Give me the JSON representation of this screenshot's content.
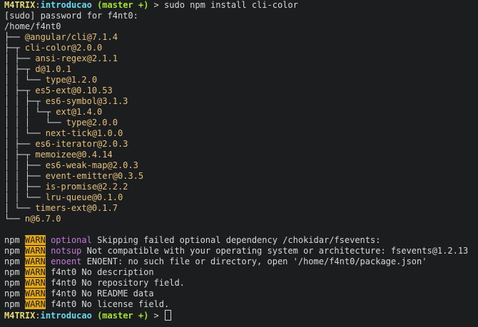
{
  "prompt1": {
    "user": "M4TRIX",
    "sep": ":",
    "dir": "introducao",
    "branch": "(master +)",
    "arrow": " > ",
    "command": "sudo npm install cli-color"
  },
  "sudo_line": "[sudo] password for f4nt0:",
  "root_path": "/home/f4nt0",
  "tree": [
    {
      "prefix": "├── ",
      "pkg": "@angular/cli@7.1.4"
    },
    {
      "prefix": "├─┬ ",
      "pkg": "cli-color@2.0.0"
    },
    {
      "prefix": "│ ├── ",
      "pkg": "ansi-regex@2.1.1"
    },
    {
      "prefix": "│ ├─┬ ",
      "pkg": "d@1.0.1"
    },
    {
      "prefix": "│ │ └── ",
      "pkg": "type@1.2.0"
    },
    {
      "prefix": "│ ├─┬ ",
      "pkg": "es5-ext@0.10.53"
    },
    {
      "prefix": "│ │ ├─┬ ",
      "pkg": "es6-symbol@3.1.3"
    },
    {
      "prefix": "│ │ │ └─┬ ",
      "pkg": "ext@1.4.0"
    },
    {
      "prefix": "│ │ │   └── ",
      "pkg": "type@2.0.0"
    },
    {
      "prefix": "│ │ └── ",
      "pkg": "next-tick@1.0.0"
    },
    {
      "prefix": "│ ├── ",
      "pkg": "es6-iterator@2.0.3"
    },
    {
      "prefix": "│ ├─┬ ",
      "pkg": "memoizee@0.4.14"
    },
    {
      "prefix": "│ │ ├── ",
      "pkg": "es6-weak-map@2.0.3"
    },
    {
      "prefix": "│ │ ├── ",
      "pkg": "event-emitter@0.3.5"
    },
    {
      "prefix": "│ │ ├── ",
      "pkg": "is-promise@2.2.2"
    },
    {
      "prefix": "│ │ └── ",
      "pkg": "lru-queue@0.1.0"
    },
    {
      "prefix": "│ └── ",
      "pkg": "timers-ext@0.1.7"
    },
    {
      "prefix": "└── ",
      "pkg": "n@6.7.0"
    }
  ],
  "npm_lines": [
    {
      "npm": "npm",
      "level": "WARN",
      "code": "optional",
      "code_color": "#c678dd",
      "msg": " Skipping failed optional dependency /chokidar/fsevents:"
    },
    {
      "npm": "npm",
      "level": "WARN",
      "code": "notsup",
      "code_color": "#c678dd",
      "msg": " Not compatible with your operating system or architecture: fsevents@1.2.13"
    },
    {
      "npm": "npm",
      "level": "WARN",
      "code": "enoent",
      "code_color": "#c678dd",
      "msg": " ENOENT: no such file or directory, open '/home/f4nt0/package.json'"
    },
    {
      "npm": "npm",
      "level": "WARN",
      "code": "",
      "code_color": "",
      "msg": "f4nt0 No description"
    },
    {
      "npm": "npm",
      "level": "WARN",
      "code": "",
      "code_color": "",
      "msg": "f4nt0 No repository field."
    },
    {
      "npm": "npm",
      "level": "WARN",
      "code": "",
      "code_color": "",
      "msg": "f4nt0 No README data"
    },
    {
      "npm": "npm",
      "level": "WARN",
      "code": "",
      "code_color": "",
      "msg": "f4nt0 No license field."
    }
  ],
  "prompt2": {
    "user": "M4TRIX",
    "sep": ":",
    "dir": "introducao",
    "branch": "(master +)",
    "arrow": " > "
  },
  "colors": {
    "background": "#1b1d1e",
    "user": "#e6db74",
    "dir": "#66d9ef",
    "branch": "#a6e22e",
    "package": "#e6c07b",
    "warn_bg": "#e6a817"
  }
}
